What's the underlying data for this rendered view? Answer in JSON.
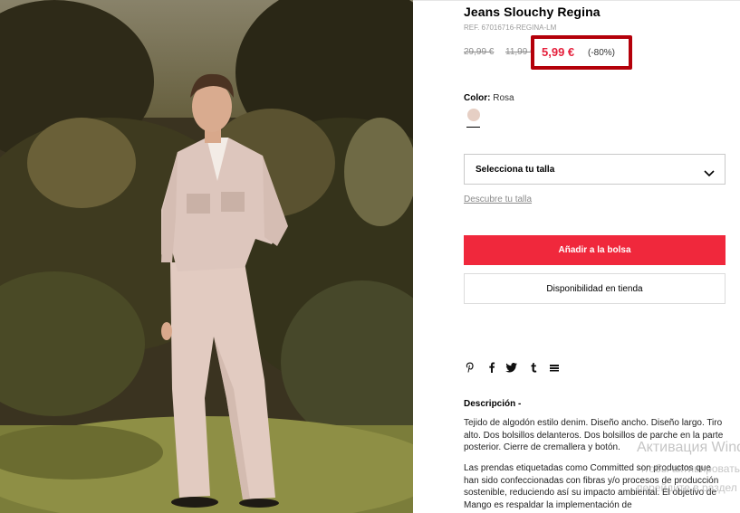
{
  "product": {
    "title": "Jeans Slouchy Regina",
    "ref": "REF. 67016716-REGINA-LM",
    "prices": {
      "original": "29,99 €",
      "previous": "11,99 €",
      "current": "5,99 €",
      "discount": "(-80%)"
    },
    "color_label": "Color:",
    "color_value": "Rosa",
    "swatch_color": "#e6cfc4",
    "size_select_label": "Selecciona tu talla",
    "size_guide_link": "Descubre tu talla",
    "add_to_bag": "Añadir a la bolsa",
    "store_availability": "Disponibilidad en tienda"
  },
  "share_icons": [
    "pinterest-icon",
    "facebook-icon",
    "twitter-icon",
    "tumblr-icon",
    "email-icon"
  ],
  "description": {
    "title": "Descripción -",
    "paragraph1": "Tejido de algodón estilo denim. Diseño ancho. Diseño largo. Tiro alto. Dos bolsillos delanteros. Dos bolsillos de parche en la parte posterior. Cierre de cremallera y botón.",
    "paragraph2": "Las prendas etiquetadas como Committed son productos que han sido confeccionadas con fibras y/o procesos de producción sostenible, reduciendo así su impacto ambiental. El objetivo de Mango es respaldar la implementación de"
  },
  "watermark": {
    "line1": "Активация Windows",
    "line2": "Чтобы активировать Windows,",
    "line3": "перейдите в раздел \"Параметры\"."
  },
  "colors": {
    "accent_red": "#f0283c",
    "highlight_box": "#b4000a",
    "price_red": "#e5203c"
  }
}
